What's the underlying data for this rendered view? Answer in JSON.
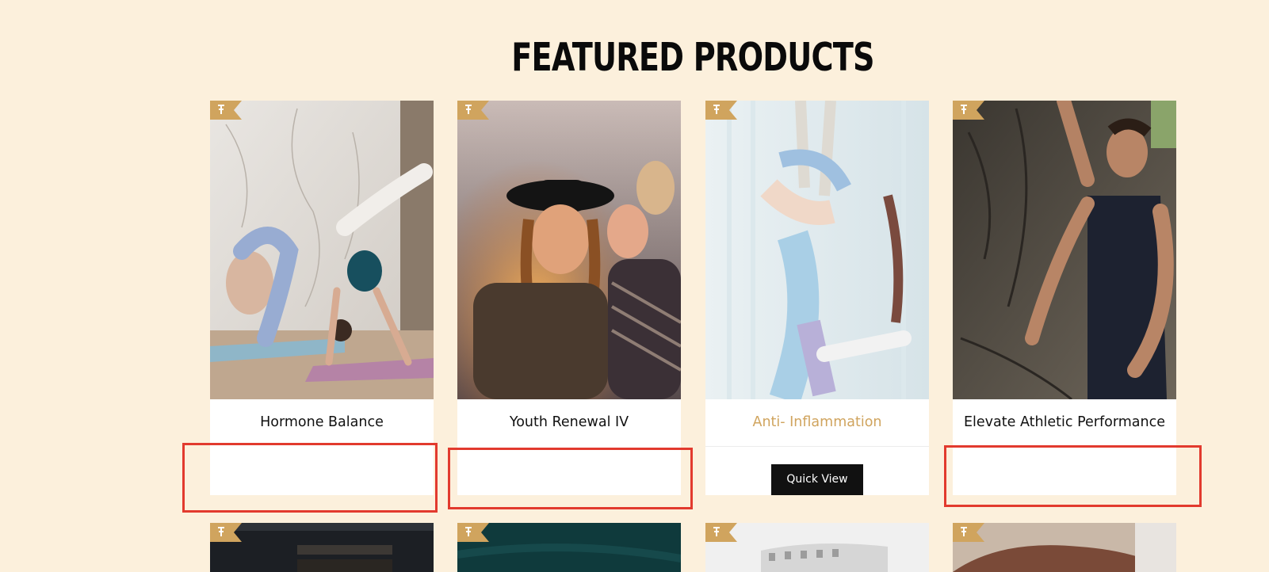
{
  "section": {
    "title": "FEATURED PRODUCTS"
  },
  "products": [
    {
      "name": "Hormone Balance"
    },
    {
      "name": "Youth Renewal IV"
    },
    {
      "name": "Anti- Inflammation",
      "quick_view_label": "Quick View"
    },
    {
      "name": "Elevate Athletic Performance"
    }
  ],
  "colors": {
    "background": "#fcf0dc",
    "accent": "#d0a45e",
    "button": "#111111",
    "highlight": "#e23a2e"
  },
  "icons": {
    "badge": "pin-icon"
  }
}
